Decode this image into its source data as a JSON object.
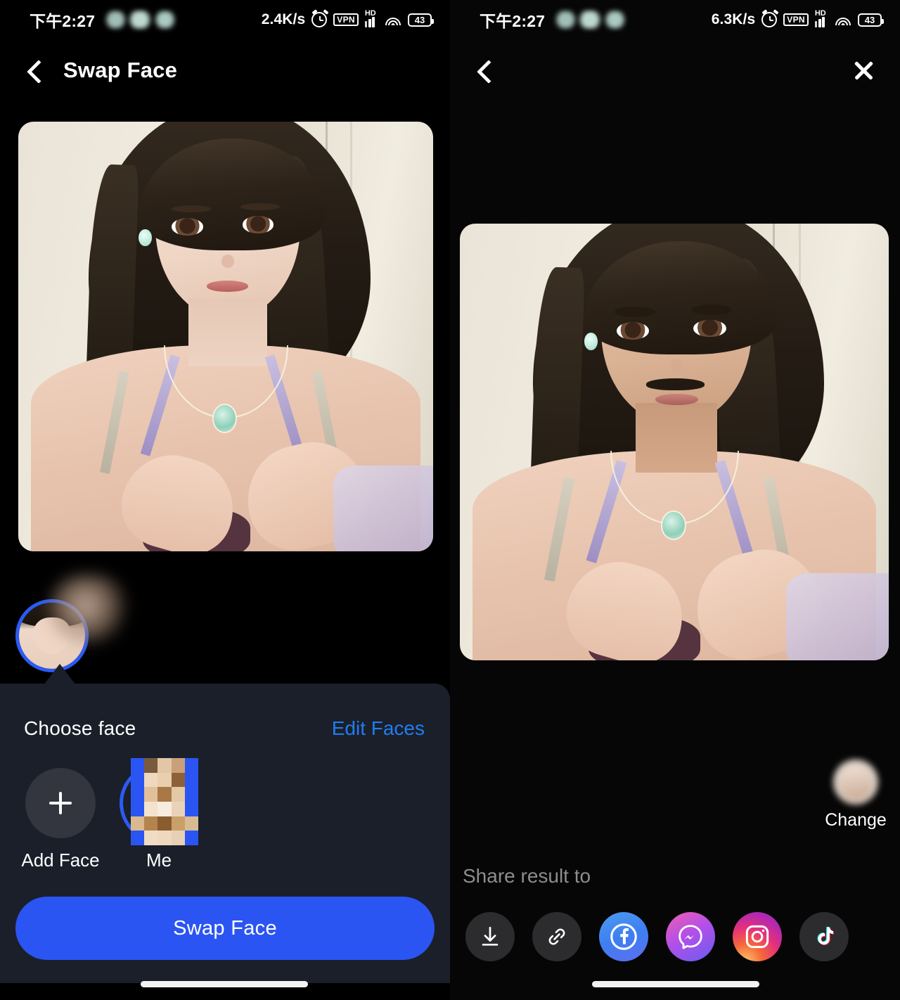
{
  "app": {
    "accent_blue": "#2b55f2",
    "link_blue": "#1f7df0",
    "sheet_bg": "#1b1f2a"
  },
  "left_screen": {
    "status": {
      "time": "下午2:27",
      "net_speed": "2.4K/s",
      "vpn_label": "VPN",
      "hd_label": "HD",
      "battery_level": "43",
      "icons": [
        "alarm-icon",
        "vpn-icon",
        "hd-signal-icon",
        "wifi-icon",
        "battery-icon"
      ]
    },
    "nav": {
      "back_icon": "chevron-left-icon",
      "title": "Swap Face"
    },
    "source_photo_alt": "source-portrait-photo",
    "selected_face_avatar": "selected-face-avatar",
    "sheet": {
      "title": "Choose face",
      "edit_link": "Edit Faces",
      "faces": [
        {
          "label": "Add Face",
          "type": "add",
          "selected": false
        },
        {
          "label": "Me",
          "type": "saved",
          "selected": true
        }
      ],
      "primary_button": "Swap Face"
    }
  },
  "right_screen": {
    "status": {
      "time": "下午2:27",
      "net_speed": "6.3K/s",
      "vpn_label": "VPN",
      "hd_label": "HD",
      "battery_level": "43",
      "icons": [
        "alarm-icon",
        "vpn-icon",
        "hd-signal-icon",
        "wifi-icon",
        "battery-icon"
      ]
    },
    "nav": {
      "back_icon": "chevron-left-icon",
      "close_icon": "close-icon"
    },
    "result_photo_alt": "face-swapped-result-photo",
    "change": {
      "label": "Change",
      "icon": "change-face-avatar"
    },
    "share": {
      "title": "Share result to",
      "targets": [
        {
          "name": "download",
          "icon": "download-icon"
        },
        {
          "name": "copy-link",
          "icon": "link-icon"
        },
        {
          "name": "facebook",
          "icon": "facebook-icon"
        },
        {
          "name": "messenger",
          "icon": "messenger-icon"
        },
        {
          "name": "instagram",
          "icon": "instagram-icon"
        },
        {
          "name": "tiktok",
          "icon": "tiktok-icon"
        }
      ]
    }
  }
}
